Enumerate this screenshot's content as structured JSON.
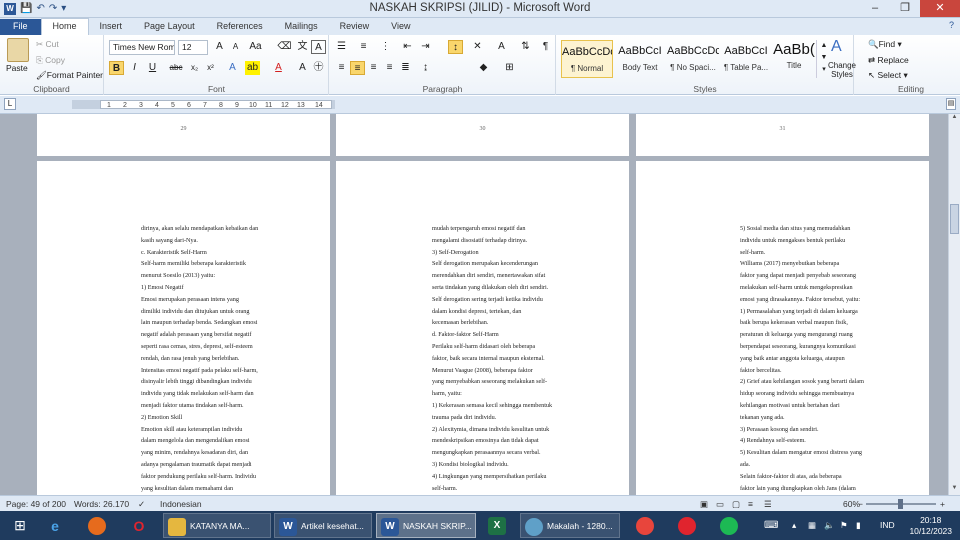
{
  "window": {
    "title": "NASKAH SKRIPSI (JILID) - Microsoft Word",
    "controls": [
      "–",
      "❐",
      "✕"
    ],
    "help": "?"
  },
  "tabs": [
    "File",
    "Home",
    "Insert",
    "Page Layout",
    "References",
    "Mailings",
    "Review",
    "View"
  ],
  "active_tab": "Home",
  "ribbon": {
    "clipboard": {
      "label": "Clipboard",
      "paste": "Paste",
      "cut": "Cut",
      "copy": "Copy",
      "format_painter": "Format Painter"
    },
    "font": {
      "label": "Font",
      "family": "Times New Roma",
      "size": "12",
      "buttons": [
        "B",
        "I",
        "U",
        "abc",
        "x₂",
        "x²"
      ]
    },
    "paragraph": {
      "label": "Paragraph"
    },
    "styles": {
      "label": "Styles",
      "items": [
        {
          "preview": "AaBbCcDc",
          "name": "¶ Normal"
        },
        {
          "preview": "AaBbCcI",
          "name": "Body Text"
        },
        {
          "preview": "AaBbCcDc",
          "name": "¶ No Spaci..."
        },
        {
          "preview": "AaBbCcI",
          "name": "¶ Table Pa..."
        },
        {
          "preview": "AaBb(",
          "name": "Title"
        }
      ],
      "change": "Change Styles"
    },
    "editing": {
      "label": "Editing",
      "find": "Find",
      "replace": "Replace",
      "select": "Select"
    }
  },
  "ruler": {
    "ticks": [
      "1",
      "2",
      "3",
      "4",
      "5",
      "6",
      "7",
      "8",
      "9",
      "10",
      "11",
      "12",
      "13",
      "14"
    ]
  },
  "pages": {
    "top_numbers": [
      "29",
      "30",
      "31"
    ],
    "left": [
      "dirinya, akan selalu mendapatkan kebaikan dan",
      "kasih sayang dari-Nya.",
      "c.   Karakteristik Self-Harm",
      "Self-harm memiliki beberapa karakteristik",
      "menurut Soesilo (2013) yaitu:",
      "1)   Emosi Negatif",
      "Emosi merupakan perasaan intens yang",
      "dimiliki individu dan ditujukan untuk orang",
      "lain maupun terhadap benda. Sedangkan emosi",
      "negatif adalah perasaan yang bersifat negatif",
      "seperti rasa cemas, stres, depresi, self-esteem",
      "rendah, dan rasa jenuh yang berlebihan.",
      "Intensitas emosi negatif pada pelaku self-harm,",
      "disinyalir lebih tinggi dibandingkan individu",
      "individu yang tidak melakukan self-harm dan",
      "menjadi faktor utama tindakan self-harm.",
      "2)   Emotion Skill",
      "Emotion skill atau keterampilan individu",
      "dalam mengelola dan mengendalikan emosi",
      "yang minim, rendahnya kesadaran diri, dan",
      "adanya pengalaman traumatik dapat menjadi",
      "faktor pendukung perilaku self-harm. Individu",
      "yang kesulitan dalam memahami dan"
    ],
    "middle": [
      "mudah terpengaruh emosi negatif dan",
      "mengalami disosiatif terhadap dirinya.",
      "3)   Self-Derogation",
      "Self derogation merupakan kecenderungan",
      "merendahkan diri sendiri, menertawakan sifat",
      "serta tindakan yang dilakukan oleh diri sendiri.",
      "Self derogation sering terjadi ketika individu",
      "dalam kondisi depresi, tertekan, dan",
      "kecemasan berlebihan.",
      "d.   Faktor-faktor Self-Harm",
      "Perilaku self-harm didasari oleh beberapa",
      "faktor, baik secara internal maupun eksternal.",
      "Menurut Vaague (2008), beberapa faktor",
      "yang menyebabkan seseorang melakukan self-",
      "harm, yaitu:",
      "1)   Kekerasan semasa kecil sehingga membentuk",
      "trauma pada diri individu.",
      "2)   Alexitymia, dimana individu kesulitan untuk",
      "mendeskripsikan emosinya dan tidak dapat",
      "mengungkapkan perasaannya secara verbal.",
      "3)   Kondisi biologikal individu.",
      "4)   Lingkungan yang mempersihatkan perilaku",
      "self-harm."
    ],
    "right": [
      "5)   Sosial media dan situs yang memudahkan",
      "individu untuk mengakses bentuk perilaku",
      "self-harm.",
      "Williams (2017) menyebutkan beberapa",
      "faktor yang dapat menjadi penyebab seseorang",
      "melakukan self-harm untuk mengekspresikan",
      "emosi yang dirasakannya. Faktor tersebut, yaitu:",
      "1)   Permasalahan yang terjadi di dalam keluarga",
      "baik berupa kekerasan verbal maupun fisik,",
      "peraturan di keluarga yang mengurangi ruang",
      "berpendapat seseorang, kurangnya komunikasi",
      "yang baik antar anggota keluarga, ataupun",
      "faktor bercelitas.",
      "2)   Grief atau kehilangan sosok yang berarti dalam",
      "hidup seorang individu sehingga membuatnya",
      "kehilangan motivasi untuk bertahan dari",
      "tekanan yang ada.",
      "3)   Perasaan kosong dan sendiri.",
      "4)   Rendahnya self-esteem.",
      "5)   Kesulitan dalam mengatur emosi distress yang",
      "ada.",
      "Selain faktor-faktor di atas, ada beberapa",
      "faktor lain yang diungkapkan oleh Jans (dalam"
    ]
  },
  "status": {
    "page": "Page: 49 of 200",
    "words": "Words: 26.170",
    "language": "Indonesian",
    "zoom": "60%"
  },
  "taskbar": {
    "apps": [
      "KATANYA MA...",
      "Artikel kesehat...",
      "NASKAH SKRIP...",
      "Makalah - 1280..."
    ],
    "lang": "IND",
    "time": "20:18",
    "date": "10/12/2023"
  },
  "colors": {
    "accent": "#2b5797",
    "taskbar": "#1f3b5e",
    "docbg": "#a8b0bc"
  }
}
